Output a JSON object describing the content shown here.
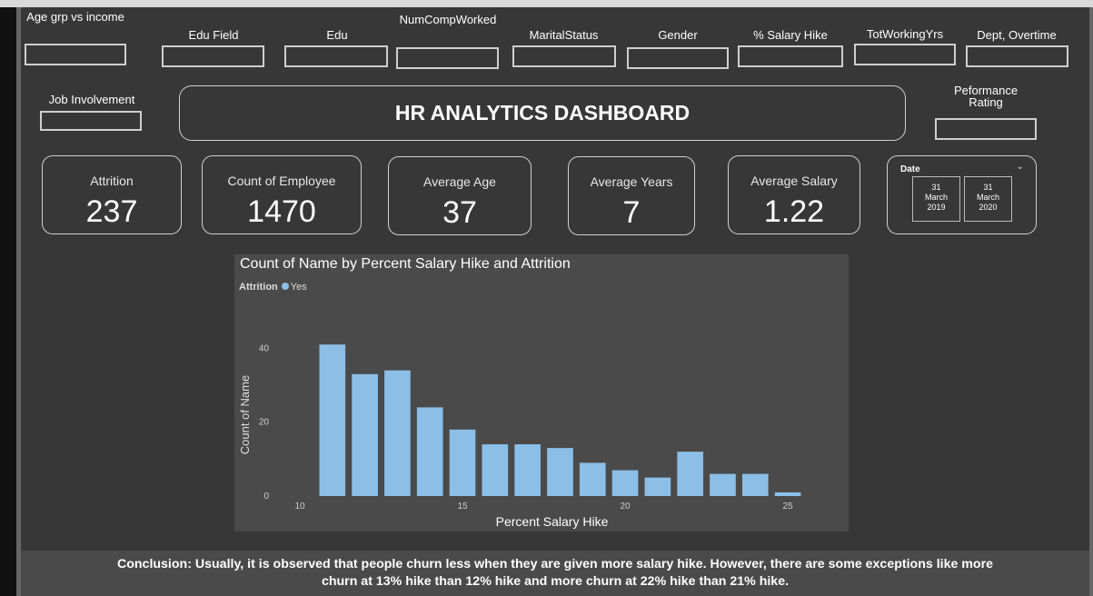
{
  "slicers": [
    {
      "label": "Age grp vs income"
    },
    {
      "label": "Edu Field"
    },
    {
      "label": "Edu"
    },
    {
      "label": "NumCompWorked"
    },
    {
      "label": "MaritalStatus"
    },
    {
      "label": "Gender"
    },
    {
      "label": "% Salary Hike"
    },
    {
      "label": "TotWorkingYrs"
    },
    {
      "label": "Dept, Overtime"
    },
    {
      "label": "Job Involvement"
    },
    {
      "label": "Peformance Rating"
    }
  ],
  "dashboard_title": "HR ANALYTICS DASHBOARD",
  "kpis": [
    {
      "label": "Attrition",
      "value": "237"
    },
    {
      "label": "Count of Employee",
      "value": "1470"
    },
    {
      "label": "Average Age",
      "value": "37"
    },
    {
      "label": "Average Years",
      "value": "7"
    },
    {
      "label": "Average Salary",
      "value": "1.22"
    }
  ],
  "date_filter": {
    "label": "Date",
    "start": {
      "day": "31",
      "month": "March",
      "year": "2019"
    },
    "end": {
      "day": "31",
      "month": "March",
      "year": "2020"
    }
  },
  "chart_data": {
    "type": "bar",
    "title": "Count of Name by Percent Salary Hike and Attrition",
    "legend_title": "Attrition",
    "xlabel": "Percent Salary Hike",
    "ylabel": "Count of Name",
    "x": [
      11,
      12,
      13,
      14,
      15,
      16,
      17,
      18,
      19,
      20,
      21,
      22,
      23,
      24,
      25
    ],
    "series": [
      {
        "name": "Yes",
        "color": "#8cbfe7",
        "values": [
          41,
          33,
          34,
          24,
          18,
          14,
          14,
          13,
          9,
          7,
          5,
          12,
          6,
          6,
          1
        ]
      }
    ],
    "xticks": [
      10,
      15,
      20,
      25
    ],
    "yticks": [
      0,
      20,
      40
    ],
    "xlim": [
      10,
      25.5
    ],
    "ylim": [
      0,
      44
    ]
  },
  "conclusion": {
    "line1": "Conclusion: Usually, it is observed that people churn less when they are given more salary hike. However, there are some exceptions like more",
    "line2": "churn at 13% hike than 12% hike and more churn at 22% hike than 21% hike."
  }
}
